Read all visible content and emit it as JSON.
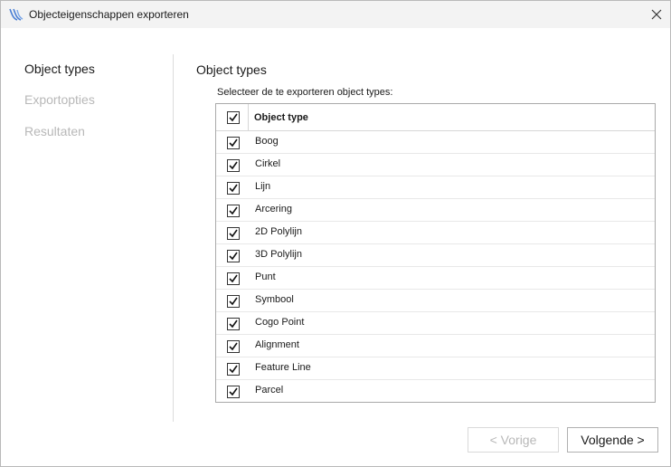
{
  "window": {
    "title": "Objecteigenschappen exporteren",
    "icons": {
      "app": "wave-app-icon",
      "close": "close-icon"
    }
  },
  "sidebar": {
    "items": [
      {
        "label": "Object types",
        "state": "active"
      },
      {
        "label": "Exportopties",
        "state": "disabled"
      },
      {
        "label": "Resultaten",
        "state": "disabled"
      }
    ]
  },
  "main": {
    "title": "Object types",
    "instruction": "Selecteer de te exporteren object types:",
    "grid": {
      "header": {
        "column": "Object type",
        "select_all_checked": true
      },
      "rows": [
        {
          "label": "Boog",
          "checked": true
        },
        {
          "label": "Cirkel",
          "checked": true
        },
        {
          "label": "Lijn",
          "checked": true
        },
        {
          "label": "Arcering",
          "checked": true
        },
        {
          "label": "2D Polylijn",
          "checked": true
        },
        {
          "label": "3D Polylijn",
          "checked": true
        },
        {
          "label": "Punt",
          "checked": true
        },
        {
          "label": "Symbool",
          "checked": true
        },
        {
          "label": "Cogo Point",
          "checked": true
        },
        {
          "label": "Alignment",
          "checked": true
        },
        {
          "label": "Feature Line",
          "checked": true
        },
        {
          "label": "Parcel",
          "checked": true
        }
      ]
    }
  },
  "footer": {
    "prev_label": "< Vorige",
    "next_label": "Volgende >"
  },
  "colors": {
    "inactive_text": "#b8b8b8",
    "titlebar_bg": "#f3f3f3",
    "app_icon": "#4a7fd4"
  }
}
